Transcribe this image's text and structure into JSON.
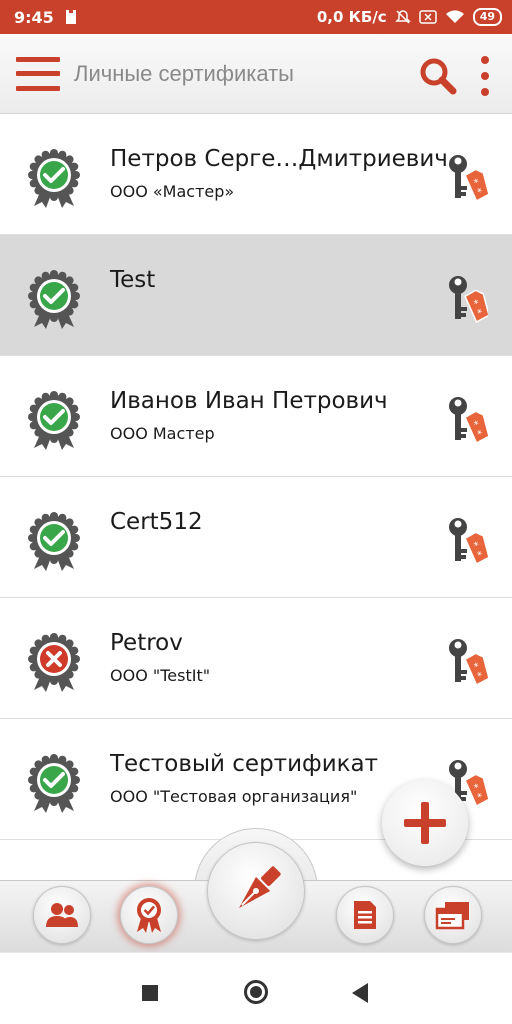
{
  "status_bar": {
    "time": "9:45",
    "net_speed": "0,0 КБ/с",
    "battery": "49"
  },
  "toolbar": {
    "title": "Личные сертификаты",
    "menu_icon": "hamburger-menu-icon",
    "search_icon": "search-icon",
    "more_icon": "more-vert-icon"
  },
  "certificates": [
    {
      "name": "Петров Серге…Дмитриевич",
      "org": "ООО «Мастер»",
      "status": "valid",
      "selected": false
    },
    {
      "name": "Test",
      "org": "",
      "status": "valid",
      "selected": true
    },
    {
      "name": "Иванов Иван Петрович",
      "org": "ООО Мастер",
      "status": "valid",
      "selected": false
    },
    {
      "name": "Cert512",
      "org": "",
      "status": "valid",
      "selected": false
    },
    {
      "name": "Petrov",
      "org": "ООО \"TestIt\"",
      "status": "invalid",
      "selected": false
    },
    {
      "name": "Тестовый сертификат",
      "org": "ООО \"Тестовая организация\"",
      "status": "valid",
      "selected": false
    }
  ],
  "bottom_nav": [
    {
      "icon": "contacts-icon",
      "active": false
    },
    {
      "icon": "certificate-badge-icon",
      "active": true
    },
    {
      "icon": "fountain-pen-icon",
      "active": false
    },
    {
      "icon": "document-icon",
      "active": false
    },
    {
      "icon": "windows-icon",
      "active": false
    }
  ],
  "colors": {
    "accent": "#c9402b",
    "valid": "#3aa64a",
    "invalid": "#cf3a2b",
    "selected_row": "#d9d9d9"
  }
}
